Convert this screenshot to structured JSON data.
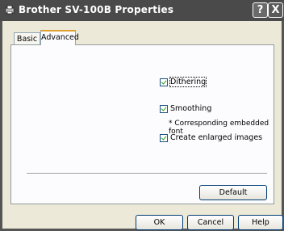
{
  "window": {
    "title": "Brother SV-100B Properties",
    "help_label": "?",
    "close_label": "X"
  },
  "tabs": [
    {
      "label": "Basic",
      "selected": false
    },
    {
      "label": "Advanced",
      "selected": true
    }
  ],
  "options": {
    "dithering": {
      "label": "Dithering",
      "checked": true
    },
    "smoothing": {
      "label": "Smoothing",
      "checked": true
    },
    "smoothing_note": "* Corresponding embedded font",
    "enlarged": {
      "label": "Create enlarged images",
      "checked": true
    }
  },
  "buttons": {
    "default": "Default",
    "ok": "OK",
    "cancel": "Cancel",
    "help": "Help"
  }
}
